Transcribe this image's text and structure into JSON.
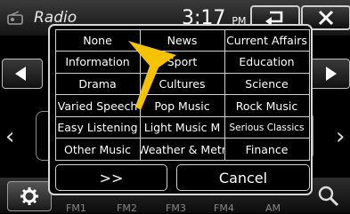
{
  "header": {
    "title": "Radio",
    "time": "3:17",
    "ampm": "PM",
    "icons": [
      "radio-icon",
      "back-arrow-icon",
      "close-icon"
    ]
  },
  "footer": {
    "bands": [
      "FM1",
      "FM2",
      "FM3",
      "FM4",
      "AM"
    ],
    "icons": [
      "gear-icon",
      "search-icon"
    ]
  },
  "popup": {
    "categories": [
      [
        "None",
        "News",
        "Current Affairs"
      ],
      [
        "Information",
        "Sport",
        "Education"
      ],
      [
        "Drama",
        "Cultures",
        "Science"
      ],
      [
        "Varied Speech",
        "Pop Music",
        "Rock Music"
      ],
      [
        "Easy Listening",
        "Light Music M",
        "Serious Classics"
      ],
      [
        "Other Music",
        "Weather & Metr",
        "Finance"
      ]
    ],
    "next_label": ">>",
    "cancel_label": "Cancel"
  },
  "colors": {
    "accent_cursor": "#f5c200",
    "border": "#d8d8d8"
  }
}
